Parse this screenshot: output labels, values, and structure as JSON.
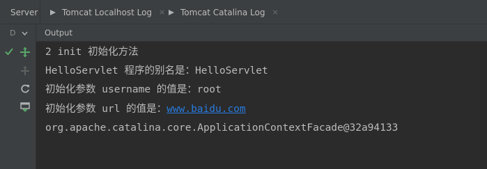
{
  "tabs": [
    {
      "label": "Server"
    },
    {
      "label": "Tomcat Localhost Log",
      "close": "×"
    },
    {
      "label": "Tomcat Catalina Log",
      "close": "×"
    }
  ],
  "subheader": {
    "gutter_label": "D",
    "output_label": "Output"
  },
  "console": {
    "lines": [
      {
        "text": "2 init 初始化方法"
      },
      {
        "text": "HelloServlet 程序的别名是：HelloServlet"
      },
      {
        "text": "初始化参数 username 的值是：root"
      },
      {
        "prefix": "初始化参数 url 的值是：",
        "link": "www.baidu.com"
      },
      {
        "text": "org.apache.catalina.core.ApplicationContextFacade@32a94133"
      }
    ]
  },
  "colors": {
    "background": "#2b2b2b",
    "panel": "#3c3f41",
    "text": "#bbbbbb",
    "link": "#287bde",
    "success_green": "#59a869"
  },
  "icons": {
    "status": "check-icon",
    "deploy": "deploy-icon",
    "undeploy": "undeploy-icon",
    "refresh": "refresh-icon",
    "update": "update-icon"
  }
}
